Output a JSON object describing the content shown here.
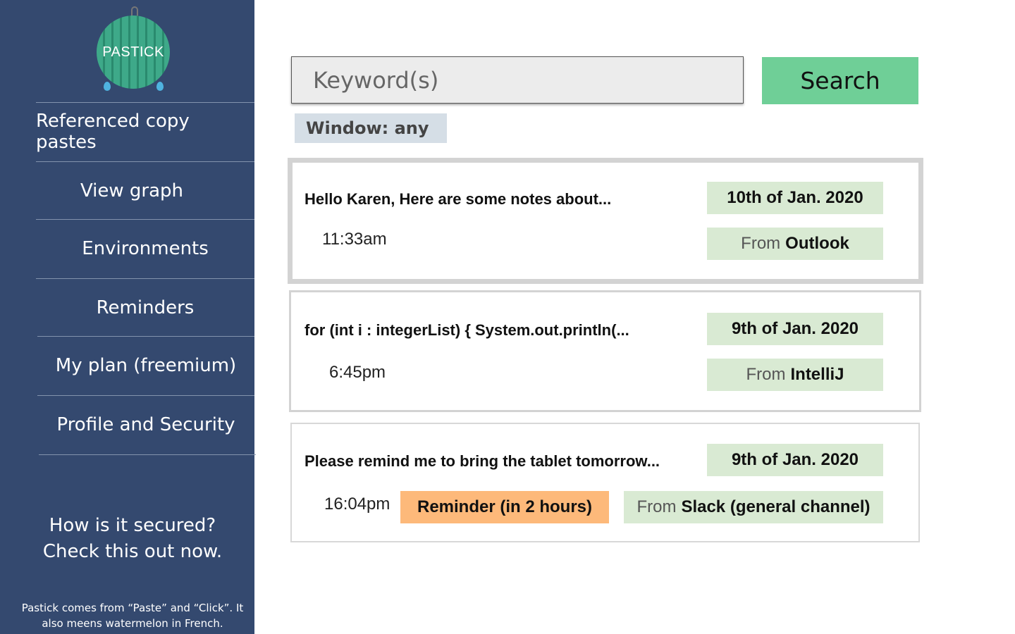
{
  "sidebar": {
    "logo_text": "PASTICK",
    "items": [
      {
        "label": "Referenced copy pastes"
      },
      {
        "label": "View graph"
      },
      {
        "label": "Environments"
      },
      {
        "label": "Reminders"
      },
      {
        "label": "My plan (freemium)"
      },
      {
        "label": "Profile and Security"
      }
    ],
    "security_line1": "How is it secured?",
    "security_line2": "Check this out now.",
    "footnote_line1": "Pastick comes from “Paste” and “Click”. It",
    "footnote_line2": "also meens watermelon in French."
  },
  "search": {
    "placeholder": "Keyword(s)",
    "button_label": "Search",
    "window_filter": "Window: any"
  },
  "entries": [
    {
      "snippet": "Hello Karen, Here are some notes about...",
      "time": "11:33am",
      "date": "10th of Jan. 2020",
      "from_label": "From",
      "source": "Outlook"
    },
    {
      "snippet": "for (int i : integerList) { System.out.println(...",
      "time": "6:45pm",
      "date": "9th of Jan. 2020",
      "from_label": "From",
      "source": "IntelliJ"
    },
    {
      "snippet": "Please remind me to bring the tablet tomorrow...",
      "time": "16:04pm",
      "date": "9th of Jan. 2020",
      "reminder": "Reminder (in 2 hours)",
      "from_label": "From",
      "source": "Slack (general channel)"
    }
  ],
  "colors": {
    "sidebar_bg": "#34496f",
    "search_button": "#6fcf97",
    "badge_green": "#d9ead3",
    "reminder_orange": "#fdb97a",
    "filter_bg": "#d5dee6"
  },
  "icons": [
    "watermelon-logo-icon",
    "water-drop-icon"
  ]
}
